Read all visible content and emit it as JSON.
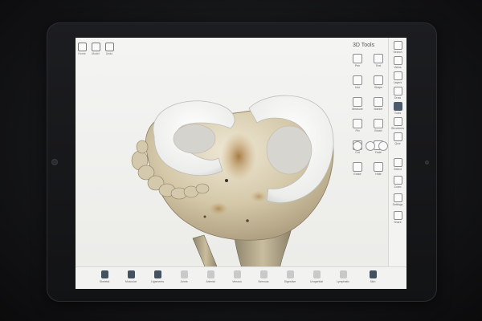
{
  "left_toolbar": [
    {
      "label": "Home"
    },
    {
      "label": "Model"
    },
    {
      "label": "Undo"
    }
  ],
  "tools_panel": {
    "title": "3D Tools",
    "items": [
      {
        "label": "Pen"
      },
      {
        "label": "Text"
      },
      {
        "label": "Line"
      },
      {
        "label": "Shape"
      },
      {
        "label": "Measure"
      },
      {
        "label": "Marker"
      },
      {
        "label": "Pin"
      },
      {
        "label": "Brush"
      },
      {
        "label": "Cut"
      },
      {
        "label": "Fade"
      },
      {
        "label": "Erase"
      },
      {
        "label": "Hide"
      }
    ],
    "circle_buttons": [
      "undo",
      "redo",
      "reset",
      "close"
    ]
  },
  "right_strip": {
    "items": [
      {
        "label": "Search"
      },
      {
        "label": "Views"
      },
      {
        "label": "Layers"
      },
      {
        "label": "Draw"
      },
      {
        "label": "Tools",
        "active": true
      },
      {
        "label": "Structures"
      },
      {
        "label": "Quiz"
      },
      {
        "label": "Select"
      },
      {
        "label": "Zoom"
      },
      {
        "label": "Settings"
      },
      {
        "label": "Share"
      }
    ]
  },
  "bottom_bar": {
    "items": [
      {
        "label": "Skeletal",
        "active": true
      },
      {
        "label": "Muscular",
        "active": true
      },
      {
        "label": "Ligaments",
        "active": true
      },
      {
        "label": "Joints",
        "active": false
      },
      {
        "label": "Arterial",
        "active": false
      },
      {
        "label": "Venous",
        "active": false
      },
      {
        "label": "Nervous",
        "active": false
      },
      {
        "label": "Digestive",
        "active": false
      },
      {
        "label": "Urogenital",
        "active": false
      },
      {
        "label": "Lymphatic",
        "active": false
      },
      {
        "label": "Skin",
        "active": true
      }
    ]
  },
  "colors": {
    "accent": "#44515f",
    "bone": "#d7cfb8",
    "cartilage": "#f2f2f0"
  }
}
